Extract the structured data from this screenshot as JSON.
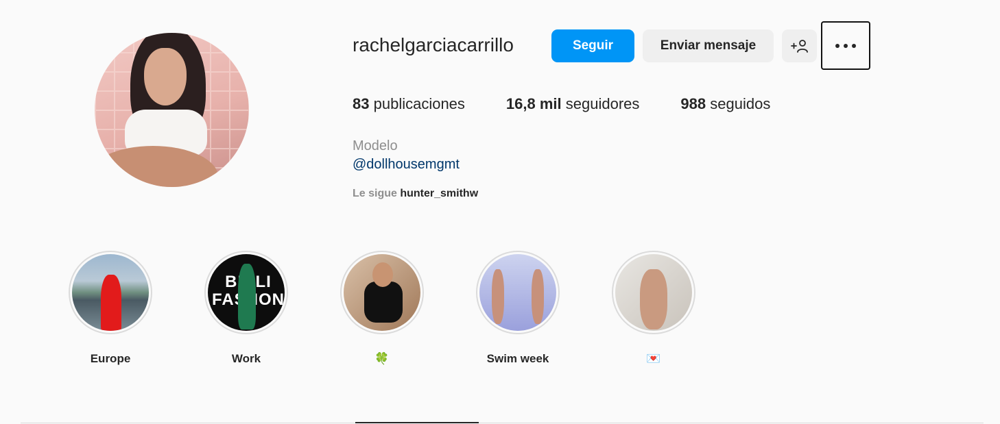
{
  "profile": {
    "username": "rachelgarciacarrillo",
    "follow_label": "Seguir",
    "message_label": "Enviar mensaje",
    "suggest_icon": "+☺",
    "stats": {
      "posts_count": "83",
      "posts_label": "publicaciones",
      "followers_count": "16,8 mil",
      "followers_label": "seguidores",
      "following_count": "988",
      "following_label": "seguidos"
    },
    "bio": {
      "category": "Modelo",
      "link": "@dollhousemgmt"
    },
    "followed_by": {
      "label": "Le sigue",
      "user": "hunter_smithw"
    }
  },
  "highlights": [
    {
      "label": "Europe"
    },
    {
      "label": "Work"
    },
    {
      "label": "🍀"
    },
    {
      "label": "Swim week"
    },
    {
      "label": "💌"
    }
  ],
  "work_image_text": "BR LI\nFASHON",
  "colors": {
    "primary": "#0095f6",
    "secondary_button": "#efefef",
    "link": "#00376b",
    "muted_text": "#8e8e8e",
    "background": "#fafafa"
  }
}
